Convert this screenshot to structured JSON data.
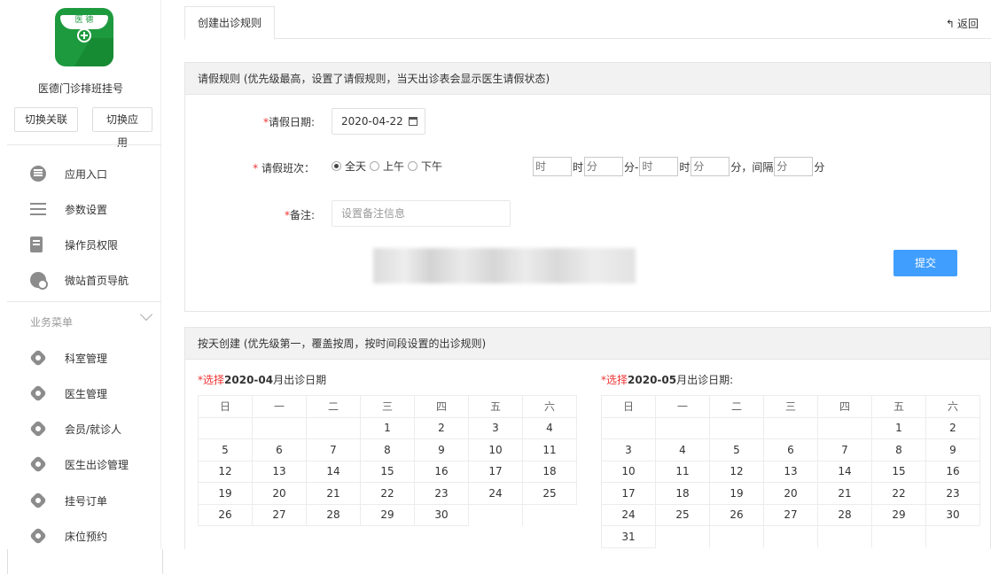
{
  "app": {
    "logo_text": "医 德",
    "name": "医德门诊排班挂号",
    "switch_link_label": "切换关联",
    "switch_app_label": "切换应用"
  },
  "sidebar": {
    "items": [
      {
        "label": "应用入口",
        "icon": "chat-bubble-icon"
      },
      {
        "label": "参数设置",
        "icon": "list-icon"
      },
      {
        "label": "操作员权限",
        "icon": "doc-edit-icon"
      },
      {
        "label": "微站首页导航",
        "icon": "nav-icon"
      }
    ],
    "group_title": "业务菜单",
    "group_items": [
      {
        "label": "科室管理",
        "icon": "gear-icon"
      },
      {
        "label": "医生管理",
        "icon": "gear-icon"
      },
      {
        "label": "会员/就诊人",
        "icon": "gear-icon"
      },
      {
        "label": "医生出诊管理",
        "icon": "gear-icon"
      },
      {
        "label": "挂号订单",
        "icon": "gear-icon"
      },
      {
        "label": "床位预约",
        "icon": "gear-icon"
      }
    ]
  },
  "header": {
    "tab_label": "创建出诊规则",
    "back_label": "返回"
  },
  "leave_panel": {
    "title": "请假规则 (优先级最高，设置了请假规则，当天出诊表会显示医生请假状态)",
    "date_label": "请假日期:",
    "date_value": "2020-04-22",
    "shift_label": "请假班次：",
    "shift_options": [
      "全天",
      "上午",
      "下午"
    ],
    "shift_selected": "全天",
    "hour_placeholder": "时",
    "minute_placeholder": "分",
    "unit_hour": "时",
    "unit_minute_dash": "分-",
    "unit_minute_interval": "分，间隔",
    "unit_minute": "分",
    "note_label": "备注:",
    "note_placeholder": "设置备注信息",
    "submit_label": "提交"
  },
  "day_panel": {
    "title": "按天创建 (优先级第一，覆盖按周，按时间段设置的出诊规则)",
    "weekdays": [
      "日",
      "一",
      "二",
      "三",
      "四",
      "五",
      "六"
    ],
    "april": {
      "caption_prefix": "*选择",
      "caption_month": "2020-04",
      "caption_suffix": "月出诊日期",
      "rows": [
        [
          "",
          "",
          "",
          "1",
          "2",
          "3",
          "4"
        ],
        [
          "5",
          "6",
          "7",
          "8",
          "9",
          "10",
          "11"
        ],
        [
          "12",
          "13",
          "14",
          "15",
          "16",
          "17",
          "18"
        ],
        [
          "19",
          "20",
          "21",
          "22",
          "23",
          "24",
          "25"
        ],
        [
          "26",
          "27",
          "28",
          "29",
          "30",
          "",
          ""
        ]
      ]
    },
    "may": {
      "caption_prefix": "*选择",
      "caption_month": "2020-05",
      "caption_suffix": "月出诊日期:",
      "rows": [
        [
          "",
          "",
          "",
          "",
          "",
          "1",
          "2"
        ],
        [
          "3",
          "4",
          "5",
          "6",
          "7",
          "8",
          "9"
        ],
        [
          "10",
          "11",
          "12",
          "13",
          "14",
          "15",
          "16"
        ],
        [
          "17",
          "18",
          "19",
          "20",
          "21",
          "22",
          "23"
        ],
        [
          "24",
          "25",
          "26",
          "27",
          "28",
          "29",
          "30"
        ],
        [
          "31",
          "",
          "",
          "",
          "",
          "",
          ""
        ]
      ]
    }
  }
}
